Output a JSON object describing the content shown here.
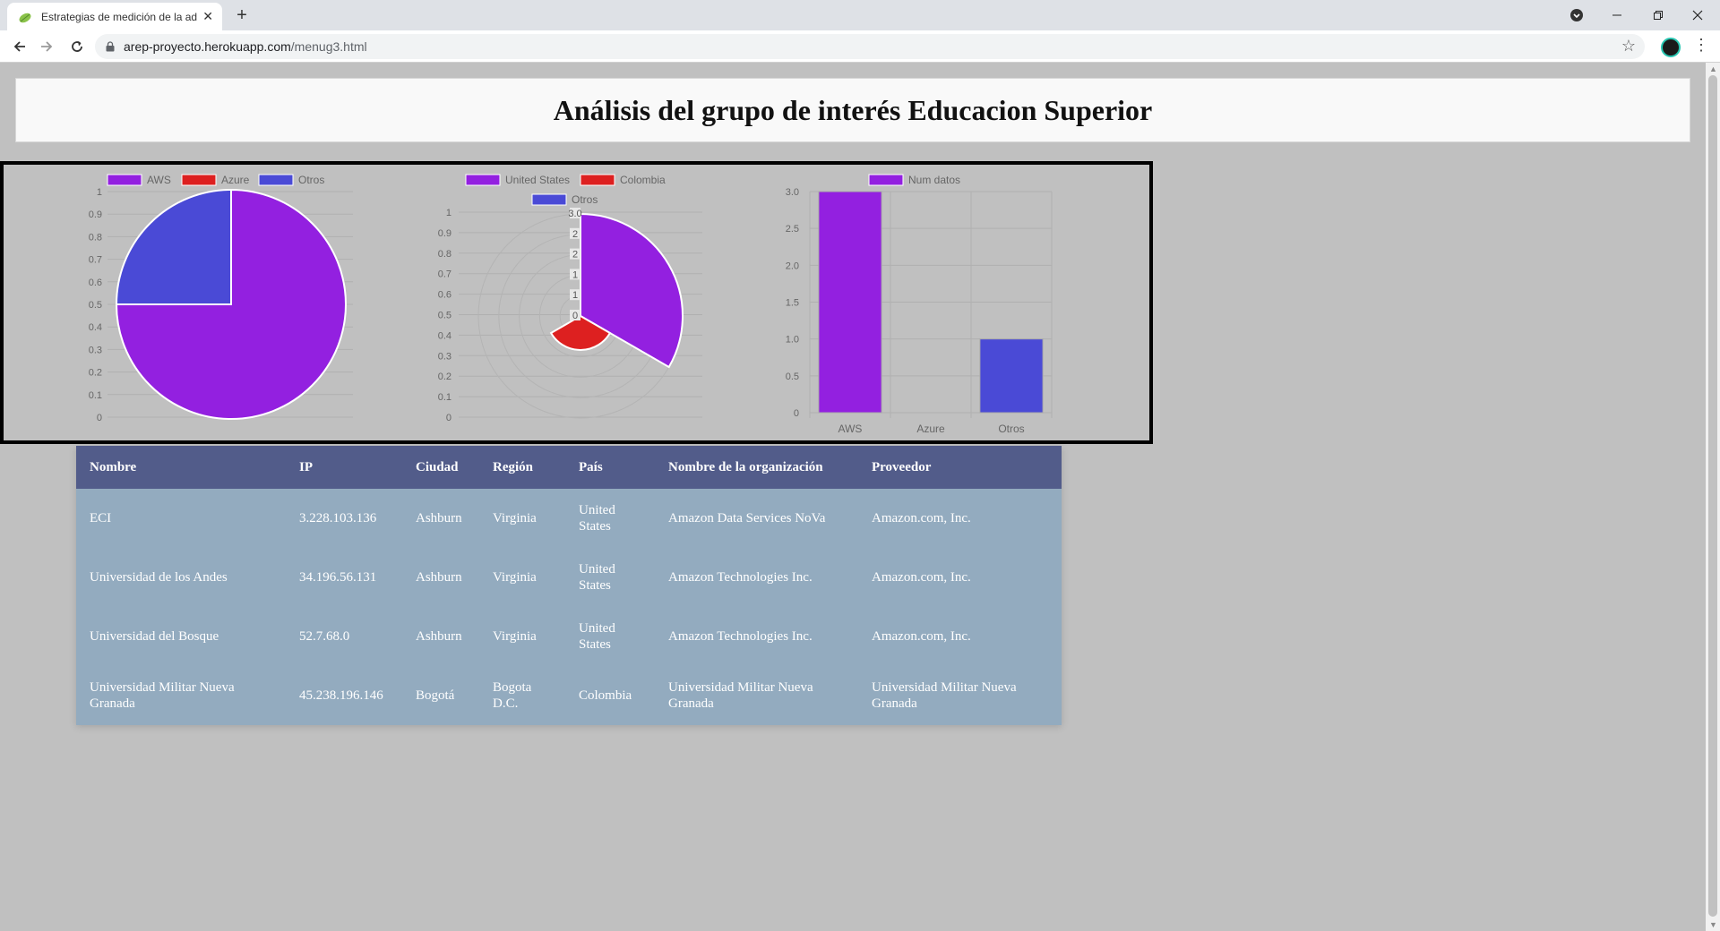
{
  "browser": {
    "tab_title": "Estrategias de medición de la adop",
    "url_host": "arep-proyecto.herokuapp.com",
    "url_path": "/menug3.html",
    "new_tab_label": "+",
    "close_tab_label": "✕"
  },
  "page": {
    "title": "Análisis del grupo de interés Educacion Superior"
  },
  "colors": {
    "purple": "#9320e0",
    "red": "#dd2020",
    "blue": "#4a4ad6",
    "header_bg": "#525c8a",
    "row_bg": "#93abbf"
  },
  "chart_data": [
    {
      "type": "pie",
      "legend": [
        "AWS",
        "Azure",
        "Otros"
      ],
      "values": [
        3,
        0,
        1
      ],
      "colors": [
        "#9320e0",
        "#dd2020",
        "#4a4ad6"
      ],
      "yticks": [
        "0",
        "0.1",
        "0.2",
        "0.3",
        "0.4",
        "0.5",
        "0.6",
        "0.7",
        "0.8",
        "0.9",
        "1"
      ],
      "legend_position": "top"
    },
    {
      "type": "polarArea",
      "legend": [
        "United States",
        "Colombia",
        "Otros"
      ],
      "values": [
        3,
        1,
        0
      ],
      "colors": [
        "#9320e0",
        "#dd2020",
        "#4a4ad6"
      ],
      "yticks": [
        "0",
        "0.1",
        "0.2",
        "0.3",
        "0.4",
        "0.5",
        "0.6",
        "0.7",
        "0.8",
        "0.9",
        "1"
      ],
      "radial_ticks": [
        "0",
        "1",
        "1",
        "2",
        "2",
        "3.0"
      ],
      "legend_position": "top"
    },
    {
      "type": "bar",
      "legend": [
        "Num datos"
      ],
      "categories": [
        "AWS",
        "Azure",
        "Otros"
      ],
      "values": [
        3,
        0,
        1
      ],
      "colors": [
        "#9320e0",
        "#dd2020",
        "#4a4ad6"
      ],
      "yticks": [
        "0",
        "0.5",
        "1.0",
        "1.5",
        "2.0",
        "2.5",
        "3.0"
      ],
      "ylim": [
        0,
        3
      ],
      "legend_position": "top"
    }
  ],
  "table": {
    "headers": [
      "Nombre",
      "IP",
      "Ciudad",
      "Región",
      "País",
      "Nombre de la organización",
      "Proveedor"
    ],
    "rows": [
      [
        "ECI",
        "3.228.103.136",
        "Ashburn",
        "Virginia",
        "United States",
        "Amazon Data Services NoVa",
        "Amazon.com, Inc."
      ],
      [
        "Universidad de los Andes",
        "34.196.56.131",
        "Ashburn",
        "Virginia",
        "United States",
        "Amazon Technologies Inc.",
        "Amazon.com, Inc."
      ],
      [
        "Universidad del Bosque",
        "52.7.68.0",
        "Ashburn",
        "Virginia",
        "United States",
        "Amazon Technologies Inc.",
        "Amazon.com, Inc."
      ],
      [
        "Universidad Militar Nueva Granada",
        "45.238.196.146",
        "Bogotá",
        "Bogota D.C.",
        "Colombia",
        "Universidad Militar Nueva Granada",
        "Universidad Militar Nueva Granada"
      ]
    ]
  }
}
